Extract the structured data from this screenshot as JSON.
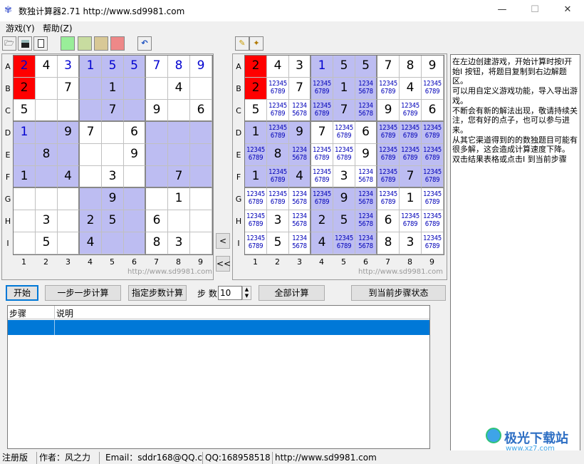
{
  "window": {
    "title": "数独计算器2.71 http://www.sd9981.com",
    "controls": [
      "—",
      "☐",
      "✕"
    ]
  },
  "menu": [
    "游戏(Y)",
    "帮助(Z)"
  ],
  "toolbar": {
    "colors": [
      "#99ee99",
      "#c8dca0",
      "#d8c896",
      "#ee8888"
    ]
  },
  "row_labels": [
    "A",
    "B",
    "C",
    "D",
    "E",
    "F",
    "G",
    "H",
    "I"
  ],
  "col_labels": [
    "1",
    "2",
    "3",
    "4",
    "5",
    "6",
    "7",
    "8",
    "9"
  ],
  "watermark": "http://www.sd9981.com",
  "colors": {
    "shade": "#bdbdf2",
    "red": "#ff0000",
    "blue_digit": "#0000d0",
    "selection": "#0078d7"
  },
  "left_grid": {
    "values": [
      [
        "2",
        "4",
        "3",
        "1",
        "5",
        "5",
        "7",
        "8",
        "9"
      ],
      [
        "2",
        "",
        "7",
        "",
        "1",
        "",
        "",
        "4",
        ""
      ],
      [
        "5",
        "",
        "",
        "",
        "7",
        "",
        "9",
        "",
        "6"
      ],
      [
        "1",
        "",
        "9",
        "7",
        "",
        "6",
        "",
        "",
        ""
      ],
      [
        "",
        "8",
        "",
        "",
        "",
        "9",
        "",
        "",
        ""
      ],
      [
        "1",
        "",
        "4",
        "",
        "3",
        "",
        "",
        "7",
        ""
      ],
      [
        "",
        "",
        "",
        "",
        "9",
        "",
        "",
        "1",
        ""
      ],
      [
        "",
        "3",
        "",
        "2",
        "5",
        "",
        "6",
        "",
        ""
      ],
      [
        "",
        "5",
        "",
        "4",
        "",
        "",
        "8",
        "3",
        ""
      ]
    ],
    "blue": [
      [
        0,
        0
      ],
      [
        0,
        2
      ],
      [
        0,
        3
      ],
      [
        0,
        4
      ],
      [
        0,
        5
      ],
      [
        0,
        6
      ],
      [
        0,
        7
      ],
      [
        0,
        8
      ],
      [
        3,
        0
      ]
    ],
    "red": [
      [
        0,
        0
      ],
      [
        1,
        0
      ]
    ],
    "shaded": [
      [
        0,
        3
      ],
      [
        0,
        4
      ],
      [
        0,
        5
      ],
      [
        1,
        3
      ],
      [
        1,
        4
      ],
      [
        1,
        5
      ],
      [
        2,
        3
      ],
      [
        2,
        4
      ],
      [
        2,
        5
      ],
      [
        3,
        0
      ],
      [
        3,
        1
      ],
      [
        3,
        2
      ],
      [
        3,
        6
      ],
      [
        3,
        7
      ],
      [
        3,
        8
      ],
      [
        4,
        0
      ],
      [
        4,
        1
      ],
      [
        4,
        2
      ],
      [
        4,
        6
      ],
      [
        4,
        7
      ],
      [
        4,
        8
      ],
      [
        5,
        0
      ],
      [
        5,
        1
      ],
      [
        5,
        2
      ],
      [
        5,
        6
      ],
      [
        5,
        7
      ],
      [
        5,
        8
      ],
      [
        6,
        3
      ],
      [
        6,
        4
      ],
      [
        6,
        5
      ],
      [
        7,
        3
      ],
      [
        7,
        4
      ],
      [
        7,
        5
      ],
      [
        8,
        3
      ],
      [
        8,
        4
      ],
      [
        8,
        5
      ]
    ]
  },
  "right_grid": {
    "values": [
      [
        "2",
        "4",
        "3",
        "1",
        "5",
        "5",
        "7",
        "8",
        "9"
      ],
      [
        "2",
        "12345\n6789",
        "7",
        "12345\n6789",
        "1",
        "1234\n5678",
        "12345\n6789",
        "4",
        "12345\n6789"
      ],
      [
        "5",
        "12345\n6789",
        "1234\n5678",
        "12345\n6789",
        "7",
        "1234\n5678",
        "9",
        "12345\n6789",
        "6"
      ],
      [
        "1",
        "12345\n6789",
        "9",
        "7",
        "12345\n6789",
        "6",
        "12345\n6789",
        "12345\n6789",
        "12345\n6789"
      ],
      [
        "12345\n6789",
        "8",
        "1234\n5678",
        "12345\n6789",
        "12345\n6789",
        "9",
        "12345\n6789",
        "12345\n6789",
        "12345\n6789"
      ],
      [
        "1",
        "12345\n6789",
        "4",
        "12345\n6789",
        "3",
        "1234\n5678",
        "12345\n6789",
        "7",
        "12345\n6789"
      ],
      [
        "12345\n6789",
        "12345\n6789",
        "1234\n5678",
        "12345\n6789",
        "9",
        "1234\n5678",
        "12345\n6789",
        "1",
        "12345\n6789"
      ],
      [
        "12345\n6789",
        "3",
        "1234\n5678",
        "2",
        "5",
        "1234\n5678",
        "6",
        "12345\n6789",
        "12345\n6789"
      ],
      [
        "12345\n6789",
        "5",
        "1234\n5678",
        "4",
        "12345\n6789",
        "1234\n5678",
        "8",
        "3",
        "12345\n6789"
      ]
    ],
    "blue": [
      [
        0,
        3
      ]
    ],
    "red": [
      [
        0,
        0
      ],
      [
        1,
        0
      ]
    ],
    "shaded": [
      [
        0,
        3
      ],
      [
        0,
        4
      ],
      [
        0,
        5
      ],
      [
        1,
        3
      ],
      [
        1,
        4
      ],
      [
        1,
        5
      ],
      [
        2,
        3
      ],
      [
        2,
        4
      ],
      [
        2,
        5
      ],
      [
        3,
        0
      ],
      [
        3,
        1
      ],
      [
        3,
        2
      ],
      [
        3,
        6
      ],
      [
        3,
        7
      ],
      [
        3,
        8
      ],
      [
        4,
        0
      ],
      [
        4,
        1
      ],
      [
        4,
        2
      ],
      [
        4,
        6
      ],
      [
        4,
        7
      ],
      [
        4,
        8
      ],
      [
        5,
        0
      ],
      [
        5,
        1
      ],
      [
        5,
        2
      ],
      [
        5,
        6
      ],
      [
        5,
        7
      ],
      [
        5,
        8
      ],
      [
        6,
        3
      ],
      [
        6,
        4
      ],
      [
        6,
        5
      ],
      [
        7,
        3
      ],
      [
        7,
        4
      ],
      [
        7,
        5
      ],
      [
        8,
        3
      ],
      [
        8,
        4
      ],
      [
        8,
        5
      ]
    ]
  },
  "copy_buttons": {
    "single": "<",
    "double": "<<"
  },
  "controls": {
    "start": "开始",
    "step": "一步一步计算",
    "n_steps": "指定步数计算",
    "steps_label": "步 数",
    "steps_value": "10",
    "all": "全部计算",
    "goto": "到当前步骤状态"
  },
  "info_text": "在左边创建游戏，开始计算时按I开始I 按钮，将题目复制到右边解题区。\n可以用自定义游戏功能，导入导出游戏。\n不断会有新的解法出现，敬请持续关注，您有好的点子，也可以参与进来。\n从其它渠道得到的的数独题目可能有很多解，这会造成计算速度下降。\n双击结果表格或点击I 到当前步骤",
  "table": {
    "headers": [
      "步骤",
      "说明"
    ]
  },
  "status": [
    "注册版",
    "作者：风之力",
    "Email：sddr168@QQ.c",
    "QQ:168958518",
    "http://www.sd9981.com"
  ],
  "brand": {
    "name": "极光下载站",
    "url": "www.xz7.com"
  }
}
